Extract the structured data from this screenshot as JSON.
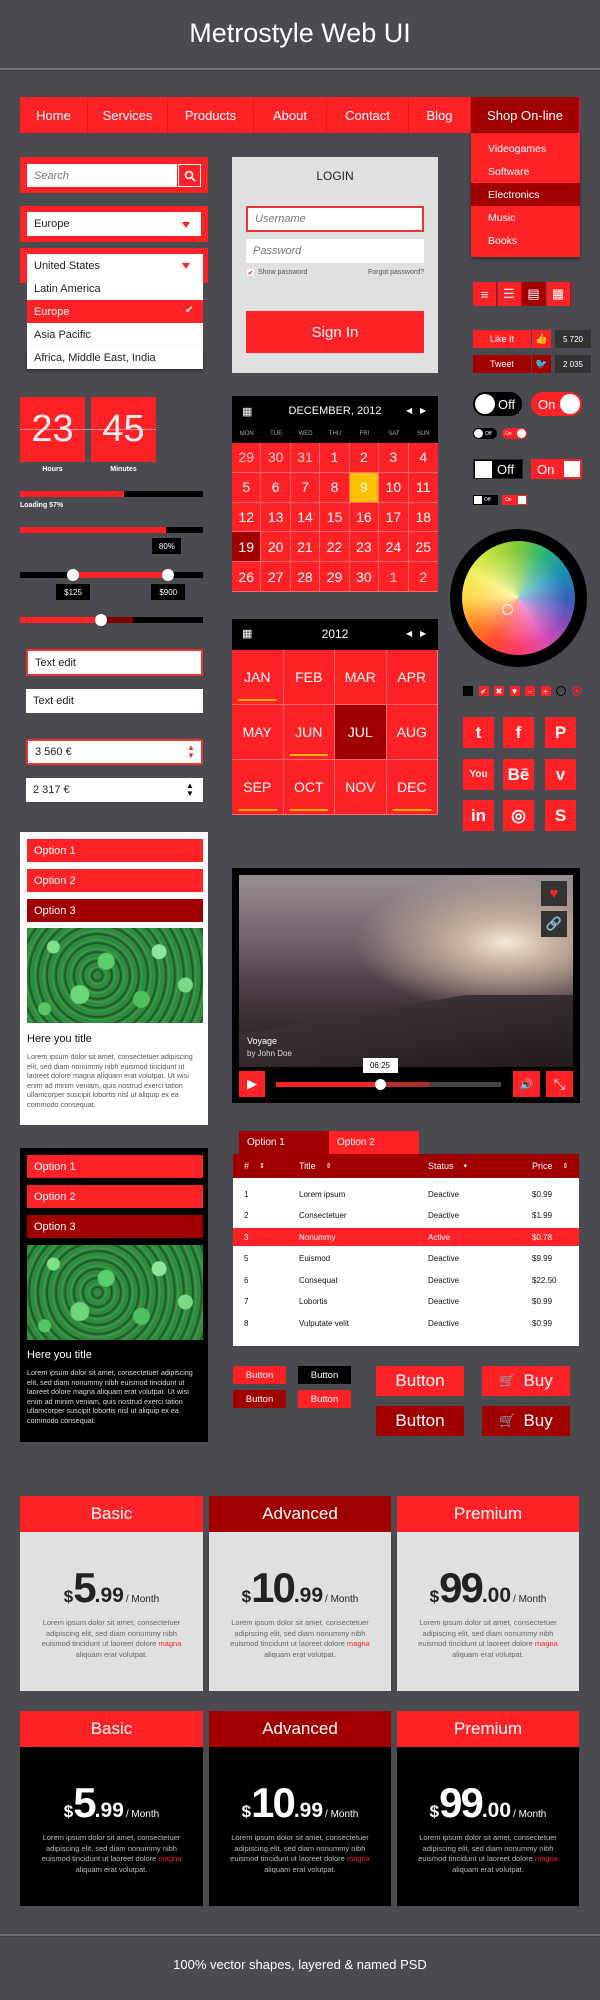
{
  "header": {
    "title": "Metrostyle Web UI"
  },
  "nav": {
    "items": [
      "Home",
      "Services",
      "Products",
      "About",
      "Contact",
      "Blog",
      "Shop On-line"
    ],
    "active": "Shop On-line",
    "dropdown": [
      "Videogames",
      "Software",
      "Electronics",
      "Music",
      "Books"
    ],
    "dropdown_active": "Electronics"
  },
  "search": {
    "placeholder": "Search",
    "icon": "search-icon"
  },
  "select1": {
    "value": "Europe"
  },
  "select2": {
    "value": "United States",
    "options": [
      "Latin America",
      "Europe",
      "Asia Pacific",
      "Africa, Middle East, India"
    ],
    "selected": "Europe"
  },
  "login": {
    "title": "LOGIN",
    "username_placeholder": "Username",
    "password_placeholder": "Password",
    "show_password": "Show password",
    "show_password_checked": true,
    "forgot": "Forgot password?",
    "sign_in": "Sign In"
  },
  "view_modes": {
    "icons": [
      "list-icon",
      "bulleted-list-icon",
      "detail-list-icon",
      "grid-icon"
    ],
    "active_index": 2
  },
  "social_counters": [
    {
      "label": "Like It",
      "icon": "thumbs-up-icon",
      "count": "5 720"
    },
    {
      "label": "Tweet",
      "icon": "twitter-icon",
      "count": "2 035"
    }
  ],
  "clock": {
    "hours": "23",
    "minutes": "45",
    "hours_label": "Hours",
    "minutes_label": "Minutes"
  },
  "progress1": {
    "percent": 57,
    "label": "Loading 57%"
  },
  "progress2": {
    "percent": 80,
    "label": "80%"
  },
  "range": {
    "low_label": "$125",
    "high_label": "$900",
    "low_percent": 29,
    "high_percent": 81
  },
  "slider": {
    "percent": 44,
    "buffered_percent": 62
  },
  "text_edits": [
    "Text edit",
    "Text edit"
  ],
  "steppers": [
    "3 560 €",
    "2 317 €"
  ],
  "calendar": {
    "title": "DECEMBER, 2012",
    "weekdays": [
      "MON",
      "TUE",
      "WED",
      "THU",
      "FRI",
      "SAT",
      "SUN"
    ],
    "days": [
      "29",
      "30",
      "31",
      "1",
      "2",
      "3",
      "4",
      "5",
      "6",
      "7",
      "8",
      "9",
      "10",
      "11",
      "12",
      "13",
      "14",
      "15",
      "16",
      "17",
      "18",
      "19",
      "20",
      "21",
      "22",
      "23",
      "24",
      "25",
      "26",
      "27",
      "28",
      "29",
      "30",
      "1",
      "2"
    ],
    "today_index": 11,
    "selected_index": 21,
    "other_month_indices": [
      0,
      1,
      2,
      33,
      34
    ]
  },
  "month_calendar": {
    "title": "2012",
    "months": [
      "JAN",
      "FEB",
      "MAR",
      "APR",
      "MAY",
      "JUN",
      "JUL",
      "AUG",
      "SEP",
      "OCT",
      "NOV",
      "DEC"
    ],
    "selected": "JUL",
    "underlined": [
      "JAN",
      "JUN",
      "SEP",
      "OCT",
      "DEC"
    ]
  },
  "toggles": {
    "off": "Off",
    "on": "On"
  },
  "form_icons": [
    "square-icon",
    "check-icon",
    "close-icon",
    "dropdown-icon",
    "minus-icon",
    "plus-icon",
    "radio-empty-icon",
    "radio-checked-icon"
  ],
  "social_icons": [
    {
      "name": "twitter-icon",
      "glyph": "t"
    },
    {
      "name": "facebook-icon",
      "glyph": "f"
    },
    {
      "name": "pinterest-icon",
      "glyph": "P"
    },
    {
      "name": "youtube-icon",
      "glyph": "You"
    },
    {
      "name": "behance-icon",
      "glyph": "Bē"
    },
    {
      "name": "vimeo-icon",
      "glyph": "v"
    },
    {
      "name": "linkedin-icon",
      "glyph": "in"
    },
    {
      "name": "dribbble-icon",
      "glyph": "◎"
    },
    {
      "name": "skype-icon",
      "glyph": "S"
    }
  ],
  "card_light": {
    "options": [
      "Option 1",
      "Option 2",
      "Option 3"
    ],
    "active": "Option 3",
    "title": "Here you title",
    "text": "Lorem ipsum dolor sit amet, consectetuer adipiscing elit, sed diam nonummy nibh euismod tincidunt ut laoreet dolore magna aliquam erat volutpat. Ut wisi enim ad minim veniam, quis nostrud exerci tation ullamcorper suscipit lobortis nisl ut aliquip ex ea commodo consequat."
  },
  "card_dark": {
    "options": [
      "Option 1",
      "Option 2",
      "Option 3"
    ],
    "active": "Option 3",
    "title": "Here you title",
    "text": "Lorem ipsum dolor sit amet, consectetuer adipiscing elit, sed diam nonummy nibh euismod tincidunt ut laoreet dolore magna aliquam erat volutpat. Ut wisi enim ad minim veniam, quis nostrud exerci tation ullamcorper suscipit lobortis nisl ut aliquip ex ea commodo consequat."
  },
  "video": {
    "title": "Voyage",
    "author": "by John Doe",
    "time": "06:25",
    "played_percent": 46,
    "buffered_percent": 68
  },
  "table": {
    "tabs": [
      "Option 1",
      "Option 2"
    ],
    "active_tab": "Option 1",
    "headers": [
      "#",
      "Title",
      "Status",
      "Price"
    ],
    "rows": [
      [
        "1",
        "Lorem ipsum",
        "Deactive",
        "$0.99"
      ],
      [
        "2",
        "Consectetuer",
        "Deactive",
        "$1.99"
      ],
      [
        "3",
        "Nonummy",
        "Active",
        "$0.78"
      ],
      [
        "5",
        "Euismod",
        "Deactive",
        "$9.99"
      ],
      [
        "6",
        "Consequat",
        "Deactive",
        "$22.50"
      ],
      [
        "7",
        "Lobortis",
        "Deactive",
        "$0.99"
      ],
      [
        "8",
        "Vulputate velit",
        "Deactive",
        "$0.99"
      ]
    ],
    "highlighted_row": 2
  },
  "buttons": {
    "small": [
      "Button",
      "Button",
      "Button",
      "Button"
    ],
    "large": [
      "Button",
      "Button"
    ],
    "buy": [
      "Buy",
      "Buy"
    ]
  },
  "pricing": {
    "plans": [
      {
        "name": "Basic",
        "currency": "$",
        "whole": "5",
        "cents": ".99",
        "period": "/ Month"
      },
      {
        "name": "Advanced",
        "currency": "$",
        "whole": "10",
        "cents": ".99",
        "period": "/ Month"
      },
      {
        "name": "Premium",
        "currency": "$",
        "whole": "99",
        "cents": ".00",
        "period": "/ Month"
      }
    ],
    "desc_before": "Lorem ipsum dolor sit amet, consectetuer adipiscing elit, sed diam nonummy nibh euismod tincidunt ut laoreet dolore ",
    "desc_highlight": "magna",
    "desc_after": " aliquam erat volutpat."
  },
  "footer": {
    "text": "100% vector shapes, layered & named PSD"
  },
  "colors": {
    "red": "#fe2226",
    "dark_red": "#a00000",
    "background": "#4a4b50",
    "highlight": "#ffc000"
  }
}
